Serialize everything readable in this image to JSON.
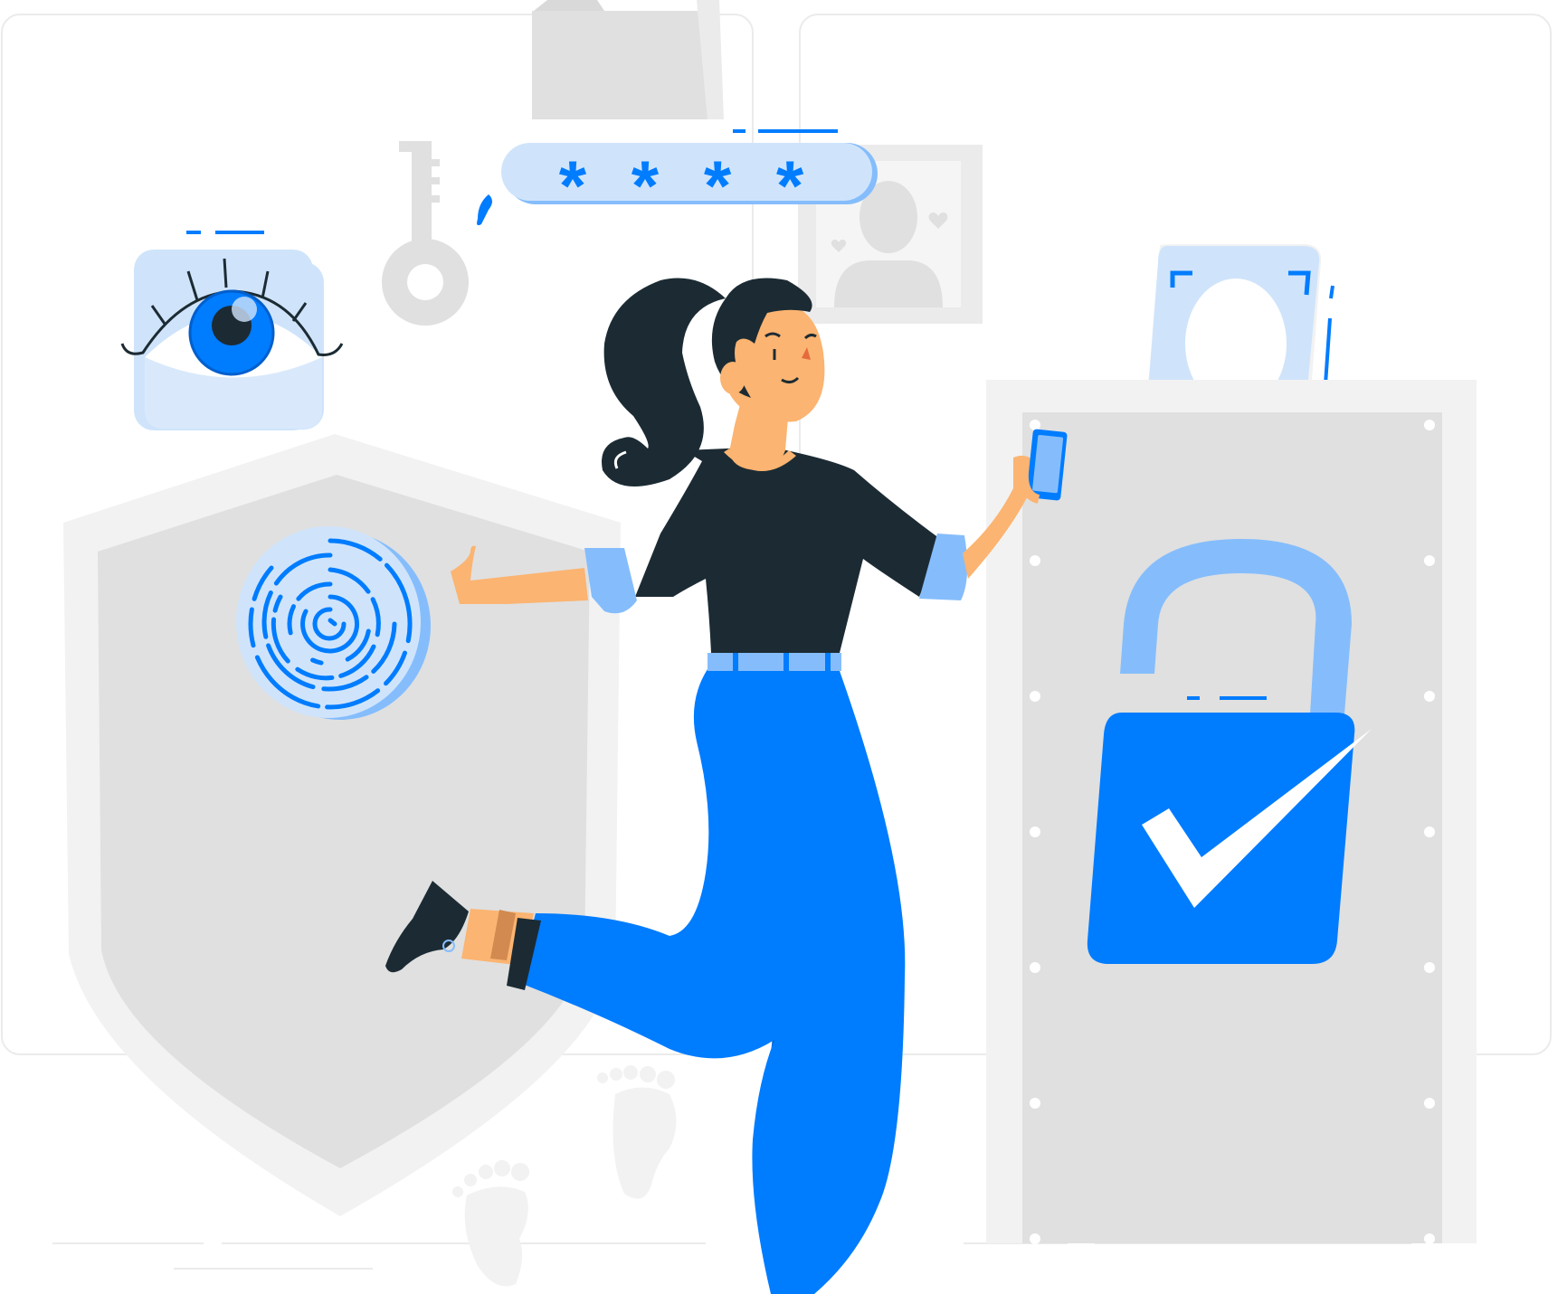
{
  "illustration": {
    "password_field": {
      "masked_value": "* * * *"
    }
  },
  "colors": {
    "accent_blue": "#007cff",
    "accent_light": "#cfe4fb",
    "accent_mid": "#85bdfc",
    "panel_gray": "#e0e0e0",
    "panel_light": "#f2f2f2",
    "hair_dark": "#1c2b33",
    "skin": "#fbb471"
  },
  "icons": [
    "eye-icon",
    "key-icon",
    "password-asterisks-icon",
    "folder-icon",
    "id-photo-icon",
    "face-scan-icon",
    "fingerprint-icon",
    "shield-icon",
    "padlock-icon",
    "checkmark-icon",
    "phone-icon",
    "footprint-icon"
  ]
}
